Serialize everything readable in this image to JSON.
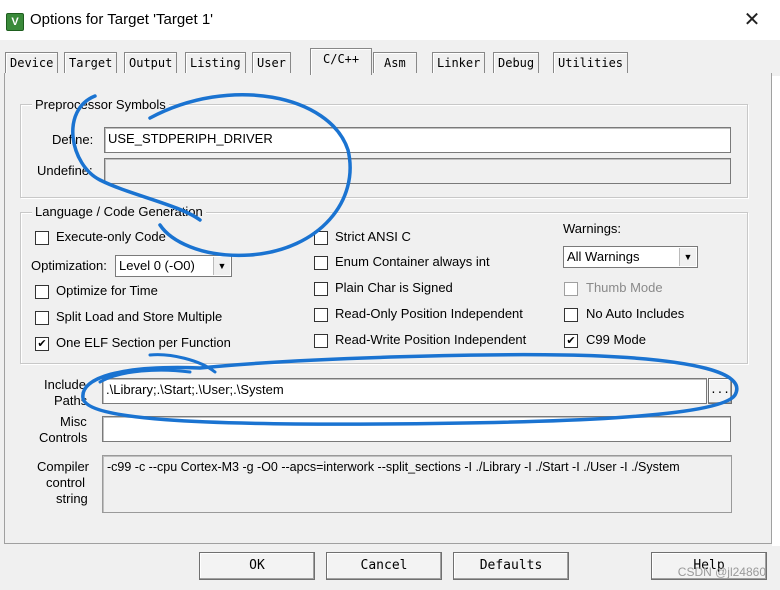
{
  "window": {
    "title": "Options for Target 'Target 1'",
    "icon": "keil-uvision-icon",
    "close": "✕"
  },
  "tabs": [
    {
      "label": "Device",
      "active": false
    },
    {
      "label": "Target",
      "active": false
    },
    {
      "label": "Output",
      "active": false
    },
    {
      "label": "Listing",
      "active": false
    },
    {
      "label": "User",
      "active": false
    },
    {
      "label": "C/C++",
      "active": true
    },
    {
      "label": "Asm",
      "active": false
    },
    {
      "label": "Linker",
      "active": false
    },
    {
      "label": "Debug",
      "active": false
    },
    {
      "label": "Utilities",
      "active": false
    }
  ],
  "preprocessor": {
    "legend": "Preprocessor Symbols",
    "define_label": "Define:",
    "define_value": "USE_STDPERIPH_DRIVER",
    "undefine_label": "Undefine:",
    "undefine_value": ""
  },
  "codegen": {
    "legend": "Language / Code Generation",
    "execute_only": {
      "label": "Execute-only Code",
      "checked": false
    },
    "optimization_label": "Optimization:",
    "optimization_value": "Level 0 (-O0)",
    "optimize_time": {
      "label": "Optimize for Time",
      "checked": false
    },
    "split_load": {
      "label": "Split Load and Store Multiple",
      "checked": false
    },
    "one_elf": {
      "label": "One ELF Section per Function",
      "checked": true
    },
    "strict_ansi": {
      "label": "Strict ANSI C",
      "checked": false
    },
    "enum_container": {
      "label": "Enum Container always int",
      "checked": false
    },
    "plain_char": {
      "label": "Plain Char is Signed",
      "checked": false
    },
    "ro_pi": {
      "label": "Read-Only Position Independent",
      "checked": false
    },
    "rw_pi": {
      "label": "Read-Write Position Independent",
      "checked": false
    },
    "warnings_label": "Warnings:",
    "warnings_value": "All Warnings",
    "thumb_mode": {
      "label": "Thumb Mode",
      "checked": false,
      "enabled": false
    },
    "no_auto_includes": {
      "label": "No Auto Includes",
      "checked": false
    },
    "c99_mode": {
      "label": "C99 Mode",
      "checked": true
    }
  },
  "include": {
    "label_line1": "Include",
    "label_line2": "Paths",
    "value": ".\\Library;.\\Start;.\\User;.\\System",
    "browse": "..."
  },
  "misc": {
    "label_line1": "Misc",
    "label_line2": "Controls",
    "value": ""
  },
  "compiler": {
    "label_line1": "Compiler",
    "label_line2": "control",
    "label_line3": "string",
    "value": "-c99 -c --cpu Cortex-M3 -g -O0 --apcs=interwork --split_sections -I ./Library -I ./Start -I ./User -I ./System"
  },
  "buttons": {
    "ok": "OK",
    "cancel": "Cancel",
    "defaults": "Defaults",
    "help": "Help"
  },
  "watermark": "CSDN @jl24860",
  "annotation_color": "#1a73d1"
}
